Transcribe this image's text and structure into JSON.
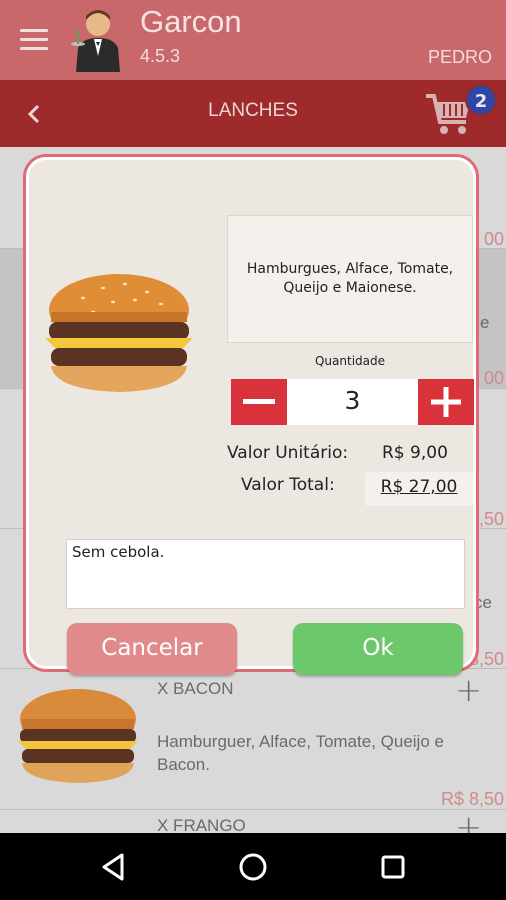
{
  "app": {
    "title": "Garcon",
    "version": "4.5.3",
    "user": "PEDRO"
  },
  "toolbar": {
    "section": "LANCHES",
    "cart_count": "2"
  },
  "list": {
    "items": [
      {
        "name": "",
        "desc": "",
        "price": "R$ 00"
      },
      {
        "name": "",
        "desc": "e",
        "price": "R$ 00"
      },
      {
        "name": "",
        "desc": "",
        "price": "R$ 8,50"
      },
      {
        "name": "",
        "desc": "ce",
        "price": "R$ 8,50"
      },
      {
        "name": "X BACON",
        "desc": "Hamburguer, Alface, Tomate, Queijo e Bacon.",
        "price": "R$ 8,50"
      },
      {
        "name": "X FRANGO",
        "desc": "",
        "price": ""
      }
    ]
  },
  "dialog": {
    "description": "Hamburgues, Alface, Tomate, Queijo e Maionese.",
    "quantity_label": "Quantidade",
    "quantity": "3",
    "unit_label": "Valor Unitário:",
    "unit_value": "R$ 9,00",
    "total_label": "Valor Total:",
    "total_value": "R$ 27,00",
    "observation": "Sem cebola.",
    "cancel_label": "Cancelar",
    "ok_label": "Ok"
  },
  "colors": {
    "appbar": "#c9686a",
    "subbar": "#9f2a2c",
    "badge": "#2f46a6",
    "qty_button": "#d8333a",
    "cancel": "#e08a8b",
    "ok": "#6cc86b",
    "dialog_border": "#e06a78"
  },
  "icons": {
    "menu": "hamburger-menu-icon",
    "avatar": "waiter-avatar",
    "back": "chevron-left-icon",
    "cart": "shopping-cart-icon",
    "add": "plus-icon",
    "nav_back": "triangle-back-icon",
    "nav_home": "circle-home-icon",
    "nav_recent": "square-recents-icon"
  }
}
